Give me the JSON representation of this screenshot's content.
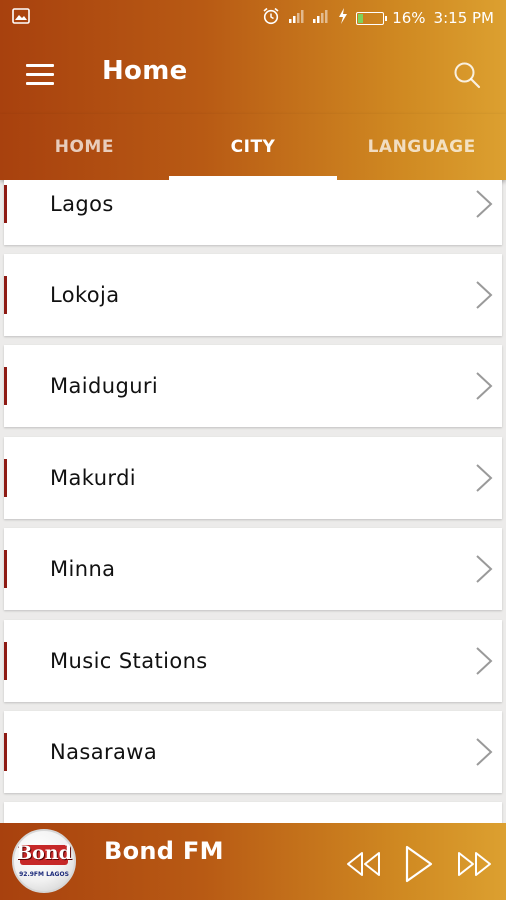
{
  "status_bar": {
    "time": "3:15 PM",
    "battery_percent": "16%",
    "icons": [
      "image-icon",
      "alarm-icon",
      "signal-icon",
      "signal-2-icon",
      "charging-icon",
      "battery-icon"
    ]
  },
  "app_bar": {
    "title": "Home",
    "menu_icon": "hamburger-menu-icon",
    "search_icon": "search-icon"
  },
  "tabs": [
    {
      "label": "HOME",
      "active": false
    },
    {
      "label": "CITY",
      "active": true
    },
    {
      "label": "LANGUAGE",
      "active": false
    }
  ],
  "cities": [
    {
      "label": "Lagos"
    },
    {
      "label": "Lokoja"
    },
    {
      "label": "Maiduguri"
    },
    {
      "label": "Makurdi"
    },
    {
      "label": "Minna"
    },
    {
      "label": "Music Stations"
    },
    {
      "label": "Nasarawa"
    }
  ],
  "player": {
    "station_name": "Bond FM",
    "logo_text": "Bond",
    "logo_subtext": "92.9FM LAGOS",
    "controls": [
      "rewind-icon",
      "play-icon",
      "fast-forward-icon"
    ]
  },
  "colors": {
    "gradient_start": "#a8410e",
    "gradient_end": "#dca030",
    "row_accent": "#8e1b14"
  }
}
